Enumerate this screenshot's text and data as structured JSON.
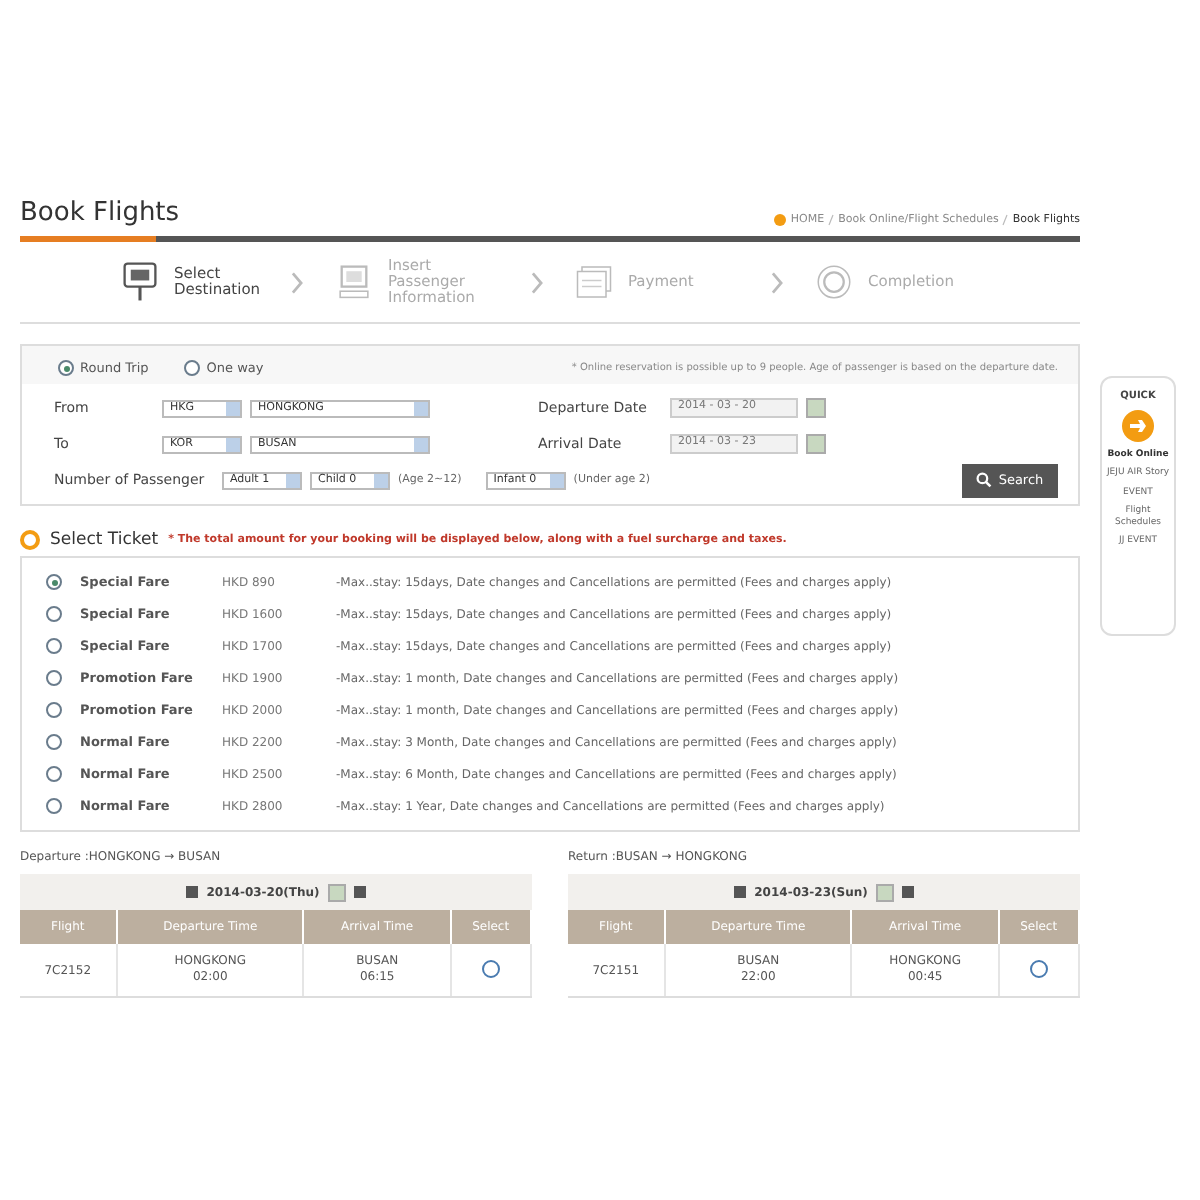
{
  "page_title": "Book Flights",
  "breadcrumb": [
    {
      "label": "HOME",
      "current": false
    },
    {
      "label": "Book Online/Flight Schedules",
      "current": false
    },
    {
      "label": "Book Flights",
      "current": true
    }
  ],
  "steps": [
    {
      "label": "Select Destination",
      "selected": true
    },
    {
      "label": "Insert Passenger Information",
      "selected": false
    },
    {
      "label": "Payment",
      "selected": false
    },
    {
      "label": "Completion",
      "selected": false
    }
  ],
  "trip_types": [
    {
      "label": "Round Trip",
      "selected": true
    },
    {
      "label": "One way",
      "selected": false
    }
  ],
  "notice": "* Online reservation is possible up to 9 people. Age of passenger is based on the departure date.",
  "from": {
    "label": "From",
    "code": "HKG",
    "city": "HONGKONG"
  },
  "to": {
    "label": "To",
    "code": "KOR",
    "city": "BUSAN"
  },
  "departure_date": {
    "label": "Departure Date",
    "value": "2014 - 03 - 20"
  },
  "arrival_date": {
    "label": "Arrival Date",
    "value": "2014 - 03 - 23"
  },
  "passengers": {
    "label": "Number of Passenger",
    "adult": "Adult 1",
    "child": "Child 0",
    "child_note": "(Age 2~12)",
    "infant": "Infant 0",
    "infant_note": "(Under age 2)"
  },
  "search_button": "Search",
  "quick_menu": {
    "title": "QUICK",
    "items": [
      "Book Online",
      "JEJU AIR Story",
      "EVENT",
      "Flight Schedules",
      "JJ EVENT"
    ]
  },
  "select_ticket": {
    "title": "Select Ticket",
    "note": "* The total amount for your booking will be displayed below, along with a fuel surcharge and taxes."
  },
  "fares": [
    {
      "name": "Special Fare",
      "price": "HKD 890",
      "terms": "-Max..stay: 15days, Date changes and Cancellations are permitted (Fees and charges apply)",
      "selected": true
    },
    {
      "name": "Special Fare",
      "price": "HKD 1600",
      "terms": "-Max..stay: 15days, Date changes and Cancellations are permitted (Fees and charges apply)",
      "selected": false
    },
    {
      "name": "Special Fare",
      "price": "HKD 1700",
      "terms": "-Max..stay: 15days, Date changes and Cancellations are permitted (Fees and charges apply)",
      "selected": false
    },
    {
      "name": "Promotion Fare",
      "price": "HKD 1900",
      "terms": "-Max..stay: 1 month, Date changes and Cancellations are permitted (Fees and charges apply)",
      "selected": false
    },
    {
      "name": "Promotion Fare",
      "price": "HKD 2000",
      "terms": "-Max..stay: 1 month, Date changes and Cancellations are permitted (Fees and charges apply)",
      "selected": false
    },
    {
      "name": "Normal Fare",
      "price": "HKD 2200",
      "terms": "-Max..stay: 3 Month, Date changes and Cancellations are permitted (Fees and charges apply)",
      "selected": false
    },
    {
      "name": "Normal Fare",
      "price": "HKD 2500",
      "terms": "-Max..stay: 6 Month, Date changes and Cancellations are permitted (Fees and charges apply)",
      "selected": false
    },
    {
      "name": "Normal Fare",
      "price": "HKD 2800",
      "terms": "-Max..stay: 1 Year, Date changes and Cancellations are permitted (Fees and charges apply)",
      "selected": false
    }
  ],
  "legs": [
    {
      "title": "Departure :HONGKONG → BUSAN",
      "date": "2014-03-20(Thu)",
      "columns": [
        "Flight",
        "Departure Time",
        "Arrival Time",
        "Select"
      ],
      "flights": [
        {
          "flight": "7C2152",
          "dep_place": "HONGKONG",
          "dep_time": "02:00",
          "arr_place": "BUSAN",
          "arr_time": "06:15",
          "selected": false
        }
      ]
    },
    {
      "title": "Return :BUSAN → HONGKONG",
      "date": "2014-03-23(Sun)",
      "columns": [
        "Flight",
        "Departure Time",
        "Arrival Time",
        "Select"
      ],
      "flights": [
        {
          "flight": "7C2151",
          "dep_place": "BUSAN",
          "dep_time": "22:00",
          "arr_place": "HONGKONG",
          "arr_time": "00:45",
          "selected": false
        }
      ]
    }
  ]
}
